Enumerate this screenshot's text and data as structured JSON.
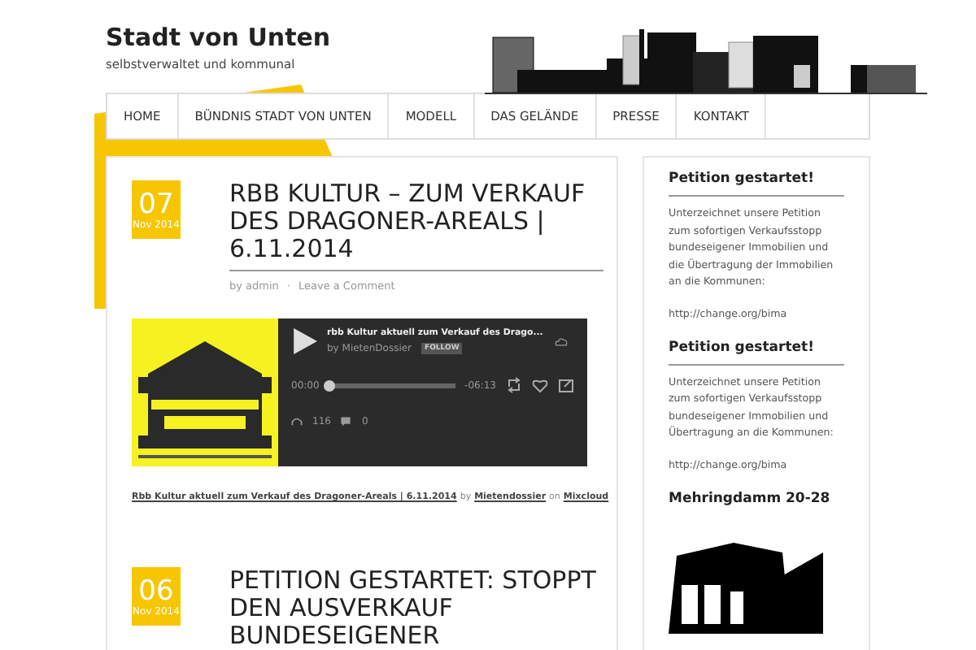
{
  "site": {
    "title": "Stadt von Unten",
    "tagline": "selbstverwaltet und kommunal"
  },
  "nav": [
    {
      "label": "HOME"
    },
    {
      "label": "BÜNDNIS STADT VON UNTEN"
    },
    {
      "label": "MODELL"
    },
    {
      "label": "DAS GELÄNDE"
    },
    {
      "label": "PRESSE"
    },
    {
      "label": "KONTAKT"
    }
  ],
  "posts": [
    {
      "day": "07",
      "month": "Nov 2014",
      "title": "RBB KULTUR – ZUM VERKAUF DES DRAGONER-AREALS | 6.11.2014",
      "author": "by admin",
      "separator": "·",
      "comment_link": "Leave a Comment",
      "player": {
        "track": "rbb Kultur aktuell zum Verkauf des Drago...",
        "by": "by MietenDossier",
        "follow": "FOLLOW",
        "elapsed": "00:00",
        "remaining": "-06:13",
        "level": 0.0,
        "plays": "116",
        "comments": "0"
      },
      "caption": {
        "link": "Rbb Kultur aktuell zum Verkauf des Dragoner-Areals | 6.11.2014",
        "by": "by",
        "user": "Mietendossier",
        "on": "on",
        "site": "Mixcloud"
      }
    },
    {
      "day": "06",
      "month": "Nov 2014",
      "title": "PETITION GESTARTET: STOPPT DEN AUSVERKAUF BUNDESEIGENER"
    }
  ],
  "sidebar": [
    {
      "kind": "text",
      "heading": "Petition gestartet!",
      "text": "Unterzeichnet unsere Petition zum sofortigen Verkaufsstopp bundeseigener Immobilien und die Übertragung der Immobilien an die Kommunen:",
      "link": "http://change.org/bima"
    },
    {
      "kind": "text",
      "heading": "Petition gestartet!",
      "text": "Unterzeichnet unsere Petition zum sofortigen Verkaufsstopp bundeseigener Immobilien und Übertragung an die Kommunen:",
      "link": "http://change.org/bima"
    },
    {
      "heading": "Mehringdamm 20-28"
    }
  ]
}
